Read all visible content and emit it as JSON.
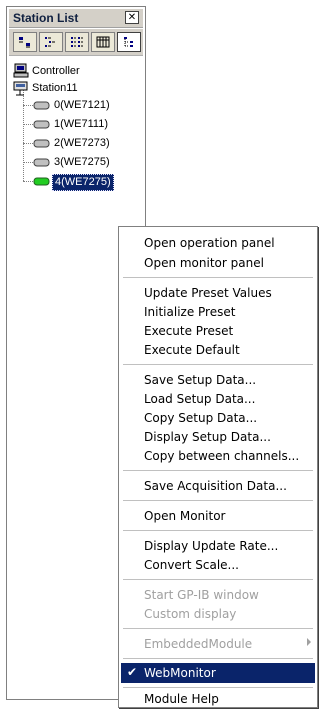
{
  "panel": {
    "title": "Station List",
    "close_glyph": "✕",
    "toolbar": [
      {
        "icon": "large-icons-view-icon"
      },
      {
        "icon": "small-icons-view-icon"
      },
      {
        "icon": "list-view-icon"
      },
      {
        "icon": "details-view-icon"
      },
      {
        "icon": "tree-view-icon",
        "active": true
      }
    ]
  },
  "tree": {
    "root": {
      "label": "Controller",
      "icon": "computer-icon"
    },
    "station": {
      "label": "Station11",
      "icon": "station-icon"
    },
    "modules": [
      {
        "label": "0(WE7121)",
        "icon": "module-icon"
      },
      {
        "label": "1(WE7111)",
        "icon": "module-icon"
      },
      {
        "label": "2(WE7273)",
        "icon": "module-icon"
      },
      {
        "label": "3(WE7275)",
        "icon": "module-icon"
      },
      {
        "label": "4(WE7275)",
        "icon": "module-active-icon",
        "selected": true
      }
    ]
  },
  "context_menu": {
    "items": [
      {
        "label": "Open operation panel"
      },
      {
        "label": "Open monitor panel"
      },
      {
        "separator": true
      },
      {
        "label": "Update Preset Values"
      },
      {
        "label": "Initialize Preset"
      },
      {
        "label": "Execute Preset"
      },
      {
        "label": "Execute Default"
      },
      {
        "separator": true
      },
      {
        "label": "Save Setup Data..."
      },
      {
        "label": "Load Setup Data..."
      },
      {
        "label": "Copy Setup Data..."
      },
      {
        "label": "Display Setup Data..."
      },
      {
        "label": "Copy between channels..."
      },
      {
        "separator": true
      },
      {
        "label": "Save Acquisition Data..."
      },
      {
        "separator": true
      },
      {
        "label": "Open Monitor"
      },
      {
        "separator": true
      },
      {
        "label": "Display Update Rate..."
      },
      {
        "label": "Convert Scale..."
      },
      {
        "separator": true
      },
      {
        "label": "Start GP-IB window",
        "disabled": true
      },
      {
        "label": "Custom display",
        "disabled": true
      },
      {
        "separator": true
      },
      {
        "label": "EmbeddedModule",
        "disabled": true,
        "submenu": true
      },
      {
        "separator": true
      },
      {
        "label": "WebMonitor",
        "checked": true,
        "highlighted": true,
        "check_glyph": "✔"
      },
      {
        "separator": true
      },
      {
        "label": "Module Help"
      }
    ]
  },
  "colors": {
    "selection": "#0a246a",
    "disabled_text": "#a0a0a0",
    "module_icon_active": "#22cc22",
    "module_icon": "#c0c0c0"
  }
}
